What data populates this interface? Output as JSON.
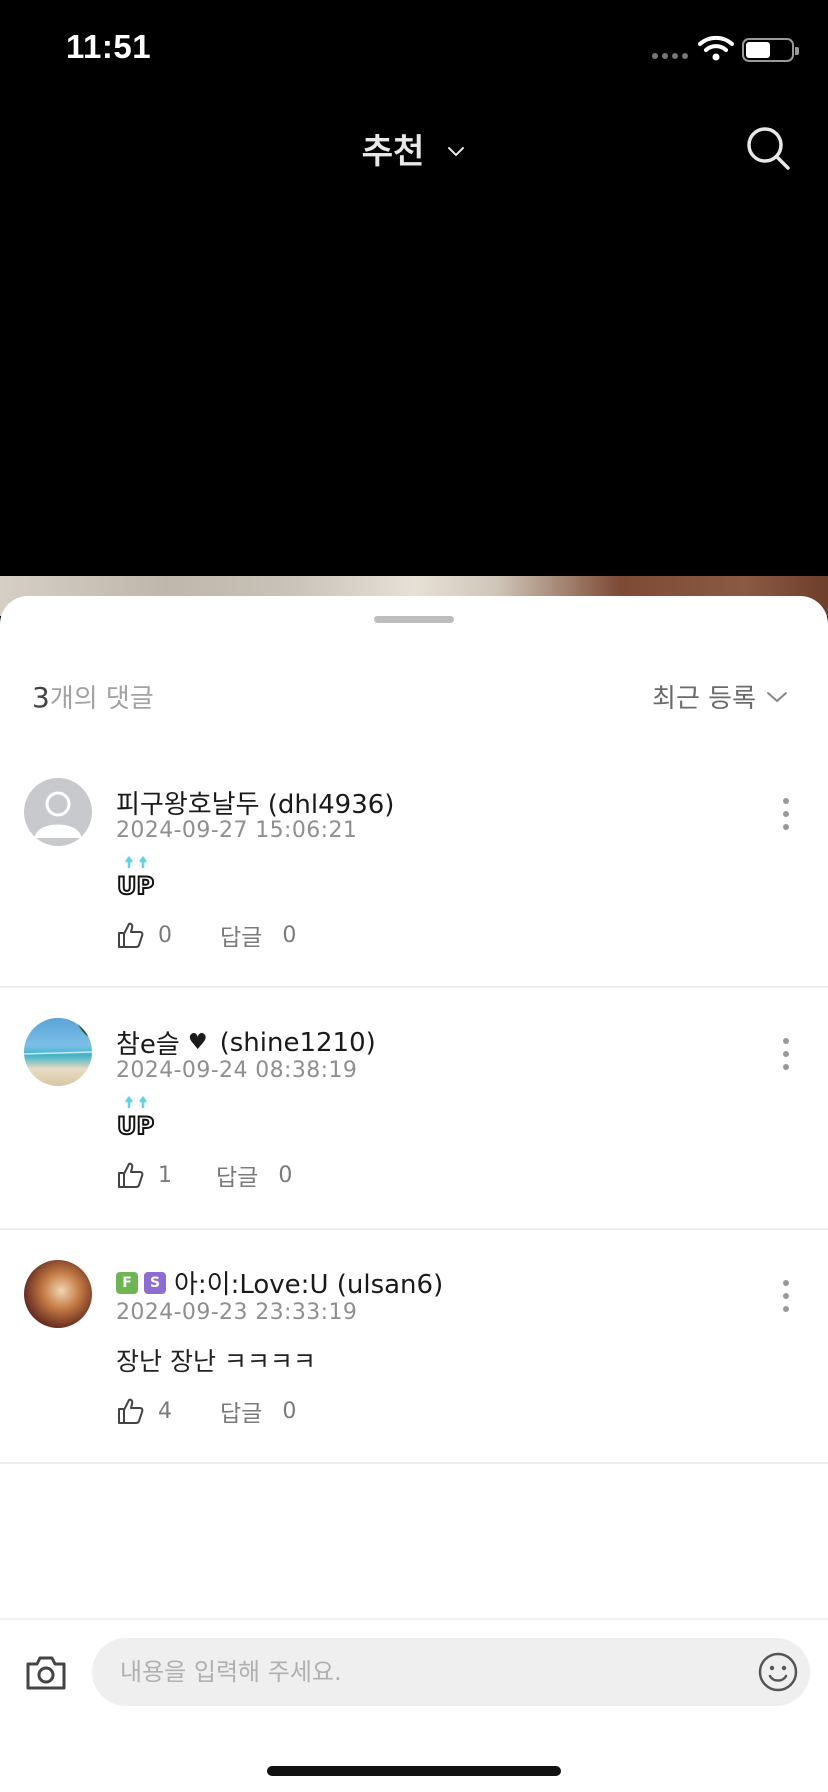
{
  "status_bar": {
    "time": "11:51"
  },
  "header": {
    "title": "추천",
    "title_icon": "chevron-down-icon",
    "search_icon": "search-icon"
  },
  "comments_sheet": {
    "count_number": "3",
    "count_suffix": "개의 댓글",
    "sort_label": "최근 등록",
    "comments": [
      {
        "author": "피구왕호날두 (dhl4936)",
        "date": "2024-09-27 15:06:21",
        "sticker": "UP",
        "likes": "0",
        "reply_label": "답글",
        "replies": "0"
      },
      {
        "author_name": "참e슬",
        "author_heart": "♥",
        "author_id": "(shine1210)",
        "date": "2024-09-24 08:38:19",
        "sticker": "UP",
        "likes": "1",
        "reply_label": "답글",
        "replies": "0"
      },
      {
        "badges": [
          "F",
          "S"
        ],
        "author": "아:이:Love:U (ulsan6)",
        "date": "2024-09-23 23:33:19",
        "text": "장난 장난 ㅋㅋㅋㅋ",
        "likes": "4",
        "reply_label": "답글",
        "replies": "0"
      }
    ]
  },
  "composer": {
    "placeholder": "내용을 입력해 주세요.",
    "camera_icon": "camera-icon",
    "emoji_icon": "smiley-icon"
  },
  "colors": {
    "accent_badge_f": "#6fb553",
    "accent_badge_s": "#8d6dd0",
    "sticker_arrow": "#5fd4e6"
  }
}
